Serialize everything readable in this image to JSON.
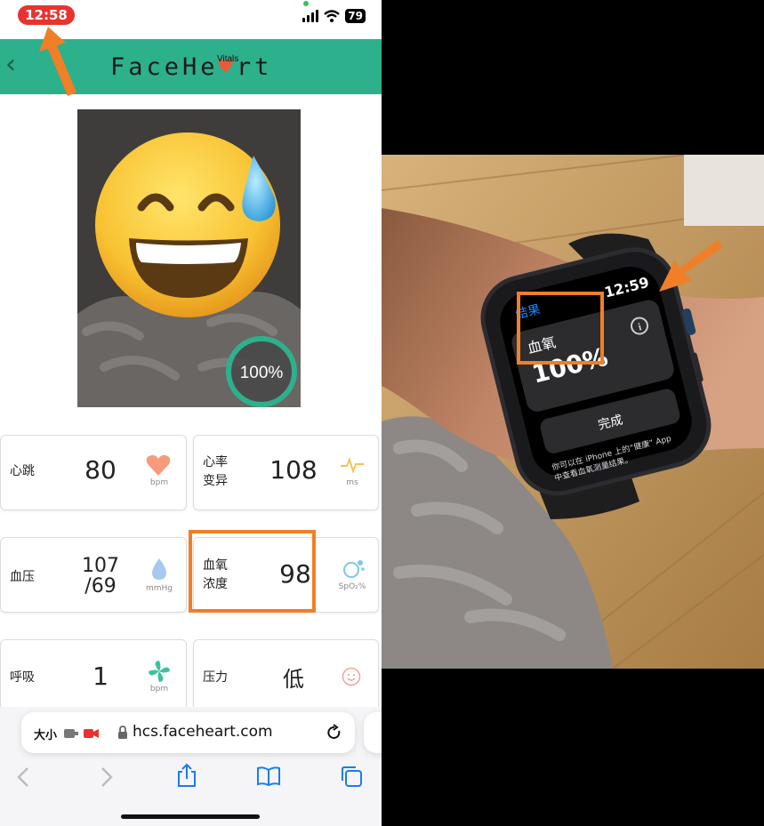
{
  "status_bar": {
    "time": "12:58",
    "battery": "79"
  },
  "app": {
    "logo_pre": "FaceHe",
    "logo_heart": "a",
    "logo_post": "rt",
    "logo_sub": "Vitals"
  },
  "camera": {
    "progress_label": "100%",
    "progress": 1.0
  },
  "metrics": [
    {
      "label_l1": "心跳",
      "label_l2": "",
      "value": "80",
      "unit": "bpm",
      "icon": "heart-icon"
    },
    {
      "label_l1": "心率",
      "label_l2": "变异",
      "value": "108",
      "unit": "ms",
      "icon": "pulse-icon"
    },
    {
      "label_l1": "血压",
      "label_l2": "",
      "value": "107",
      "value2": "/69",
      "unit": "mmHg",
      "icon": "droplet-icon"
    },
    {
      "label_l1": "血氧",
      "label_l2": "浓度",
      "value": "98",
      "unit": "SpO₂%",
      "icon": "bubbles-icon"
    },
    {
      "label_l1": "呼吸",
      "label_l2": "",
      "value": "1",
      "unit": "bpm",
      "icon": "fan-icon"
    },
    {
      "label_l1": "压力",
      "label_l2": "",
      "value": "低",
      "unit": "",
      "icon": "smiley-icon"
    }
  ],
  "browser": {
    "size_label": "大小",
    "url": "hcs.faceheart.com"
  },
  "watch": {
    "back_label": "结果",
    "time": "12:59",
    "metric_label": "血氧",
    "metric_value": "100%",
    "done_label": "完成",
    "note_line1": "你可以在 iPhone 上的“健康” App",
    "note_line2": "中查看血氧测量结果。"
  },
  "colors": {
    "accent_green": "#2db08c",
    "highlight_orange": "#f07f27",
    "status_red": "#e8332f"
  }
}
